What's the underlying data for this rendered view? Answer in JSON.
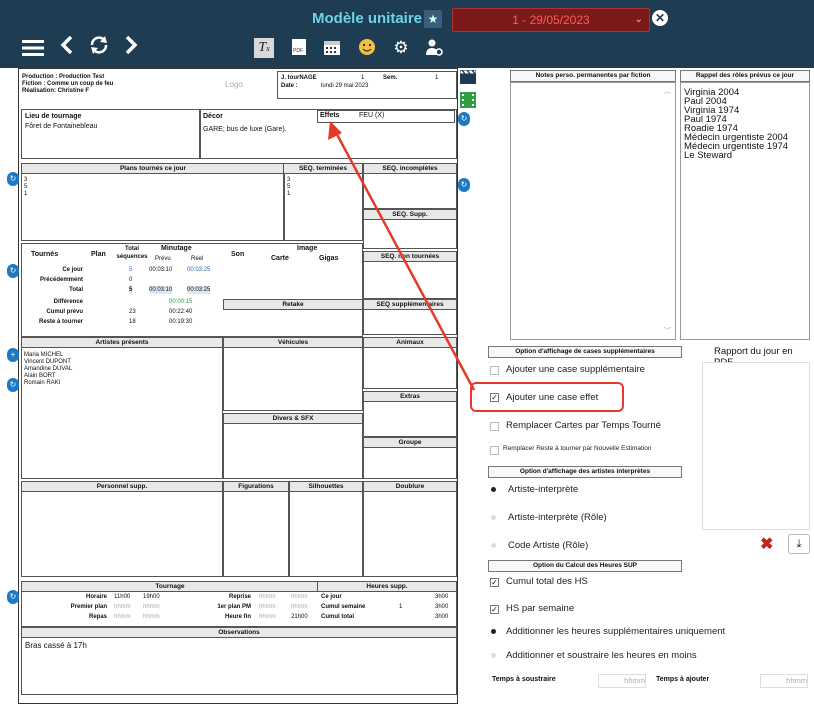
{
  "topbar": {
    "title": "Modèle unitaire",
    "date_selector": "1 - 29/05/2023",
    "tools": [
      "Tx",
      "PDF",
      "calendar",
      "smiley",
      "settings",
      "user-settings"
    ]
  },
  "sheet": {
    "production": "Production : Production Test",
    "fiction": "Fiction : Comme un coup de feu",
    "realisation": "Réalisation: Christine F",
    "logo": "Logo",
    "jour_label": "J. tourNAGE",
    "jour_value": "1",
    "sem_label": "Sem.",
    "sem_value": "1",
    "date_label": "Date :",
    "date_value": "lundi 29 mai 2023",
    "lieu_label": "Lieu de tournage",
    "lieu_value": "Fôret de Fontainebleau",
    "decor_label": "Décor",
    "decor_value": "GARE; bus de luxe (Gare).",
    "effets_label": "Effets",
    "effets_value": "FEU (X)",
    "plans_header": "Plans tournés ce jour",
    "plans_values": [
      "3",
      "5",
      "1"
    ],
    "seq_terminees": "SEQ. terminées",
    "seq_terminees_values": [
      "3",
      "5",
      "1"
    ],
    "seq_incompletes": "SEQ. incomplètes",
    "seq_supp": "SEQ. Supp.",
    "seq_non_tournees": "SEQ. non tournées",
    "seq_supplementaires": "SEQ supplémentaires",
    "table": {
      "tournes": "Tournés",
      "plan": "Plan",
      "total_seq": "Total séquences",
      "minutage": "Minutage",
      "prevu": "Prévu",
      "reel": "Réel",
      "son": "Son",
      "image": "Image",
      "carte": "Carte",
      "gigas": "Gigas",
      "rows": [
        {
          "label": "Ce jour",
          "seq": "5",
          "prevu": "00:03:10",
          "reel": "00:03:25"
        },
        {
          "label": "Précédemment",
          "seq": "0",
          "prevu": "",
          "reel": ""
        },
        {
          "label": "Total",
          "seq": "5",
          "prevu": "00:03:10",
          "reel": "00:03:25"
        }
      ],
      "difference_label": "Différence",
      "difference_value": "00:00:15",
      "cumul_label": "Cumul prévu",
      "cumul_seq": "23",
      "cumul_value": "00:22:40",
      "reste_label": "Reste à tourner",
      "reste_seq": "18",
      "reste_value": "00:19:30"
    },
    "retake": "Retake",
    "artistes_header": "Artistes présents",
    "artistes": [
      "Maria MICHEL",
      "Vincent DUPONT",
      "Amandine DUVAL",
      "Alain BORT",
      "Romain RAKI"
    ],
    "vehicules": "Véhicules",
    "animaux": "Animaux",
    "extras": "Extras",
    "divers": "Divers & SFX",
    "groupe": "Groupe",
    "personnel": "Personnel supp.",
    "figurations": "Figurations",
    "silhouettes": "Silhouettes",
    "doublure": "Doublure",
    "tournage_header": "Tournage",
    "heures_supp_header": "Heures supp.",
    "horaire_label": "Horaire",
    "horaire_start": "11h00",
    "horaire_end": "19h00",
    "premier_plan_label": "Premier plan",
    "repas_label": "Repas",
    "reprise_label": "Reprise",
    "premier_plan_pm_label": "1er plan PM",
    "heure_fin_label": "Heure fin",
    "heure_fin_value": "21h00",
    "placeholder": "hhmm",
    "ce_jour_label": "Ce jour",
    "ce_jour_value": "3h00",
    "cumul_semaine_label": "Cumul semaine",
    "cumul_semaine_num": "1",
    "cumul_semaine_value": "3h00",
    "cumul_total_label": "Cumul total",
    "cumul_total_value": "3h00",
    "observations_header": "Observations",
    "observations_value": "Bras cassé à 17h"
  },
  "right": {
    "notes_header": "Notes perso. permanentes par fiction",
    "rappel_header": "Rappel des rôles prévus ce jour",
    "rappel_items": [
      "Virginia 2004",
      "Paul 2004",
      "Virginia 1974",
      "Paul 1974",
      "Roadie 1974",
      "Médecin urgentiste 2004",
      "Médecin urgentiste 1974",
      "Le Steward"
    ],
    "option_cases_header": "Option d'affichage de cases supplémentaires",
    "rapport_label": "Rapport du jour en PDF",
    "opt_case_supp": "Ajouter une case supplémentaire",
    "opt_case_effet": "Ajouter une case effet",
    "opt_remplacer_cartes": "Remplacer Cartes par Temps Tourné",
    "opt_remplacer_reste": "Remplacer Reste à tourner par Nouvelle Estimation",
    "option_artistes_header": "Option d'affichage des artistes interprètes",
    "radio_artiste": "Artiste-interprète",
    "radio_artiste_role": "Artiste-interprète (Rôle)",
    "radio_code": "Code Artiste (Rôle)",
    "option_calcul_header": "Option du Calcul des Heures SUP",
    "opt_cumul_total": "Cumul total des HS",
    "opt_hs_semaine": "HS par semaine",
    "radio_additionner": "Additionner les heures supplémentaires uniquement",
    "radio_additionner_soustraire": "Additionner et soustraire les heures en moins",
    "temps_soustraire": "Temps à soustraire",
    "temps_ajouter": "Temps à ajouter",
    "placeholder": "hhmm"
  },
  "colors": {
    "topbar": "#1f3d52",
    "accent": "#6fd3e6",
    "annotation": "#e53a2a",
    "date": "#ff5a5a"
  }
}
